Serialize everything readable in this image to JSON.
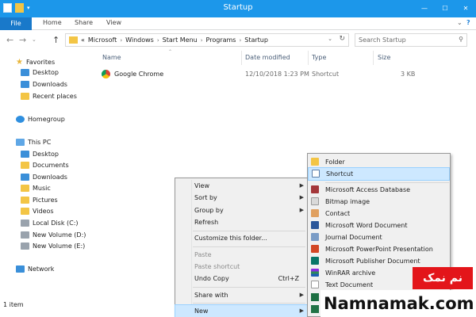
{
  "window": {
    "title": "Startup"
  },
  "ribbon": {
    "tabs": [
      "File",
      "Home",
      "Share",
      "View"
    ]
  },
  "address": {
    "overflow": "«",
    "crumbs": [
      "Microsoft",
      "Windows",
      "Start Menu",
      "Programs",
      "Startup"
    ],
    "search_placeholder": "Search Startup"
  },
  "sidebar": {
    "favorites": "Favorites",
    "fav_items": [
      "Desktop",
      "Downloads",
      "Recent places"
    ],
    "homegroup": "Homegroup",
    "thispc": "This PC",
    "pc_items": [
      "Desktop",
      "Documents",
      "Downloads",
      "Music",
      "Pictures",
      "Videos",
      "Local Disk (C:)",
      "New Volume (D:)",
      "New Volume (E:)"
    ],
    "network": "Network"
  },
  "columns": [
    "Name",
    "Date modified",
    "Type",
    "Size"
  ],
  "files": [
    {
      "name": "Google Chrome",
      "date": "12/10/2018 1:23 PM",
      "type": "Shortcut",
      "size": "3 KB"
    }
  ],
  "status": {
    "count": "1 item"
  },
  "context_menu": {
    "items": [
      "View",
      "Sort by",
      "Group by",
      "Refresh",
      "Customize this folder...",
      "Paste",
      "Paste shortcut",
      "Undo Copy",
      "Share with",
      "New"
    ],
    "undo_shortcut": "Ctrl+Z"
  },
  "submenu": {
    "items": [
      "Folder",
      "Shortcut",
      "Microsoft Access Database",
      "Bitmap image",
      "Contact",
      "Microsoft Word Document",
      "Journal Document",
      "Microsoft PowerPoint Presentation",
      "Microsoft Publisher Document",
      "WinRAR archive",
      "Text Document"
    ]
  },
  "watermark": {
    "farsi": "نم نمک",
    "site": "Namnamak.com"
  },
  "colors": {
    "titlebar": "#1c97ea",
    "file_tab": "#1979ca",
    "menu_bg": "#f0f0f0",
    "highlight": "#cde8ff",
    "folder": "#f3c545",
    "watermark_red": "#e3151a"
  }
}
